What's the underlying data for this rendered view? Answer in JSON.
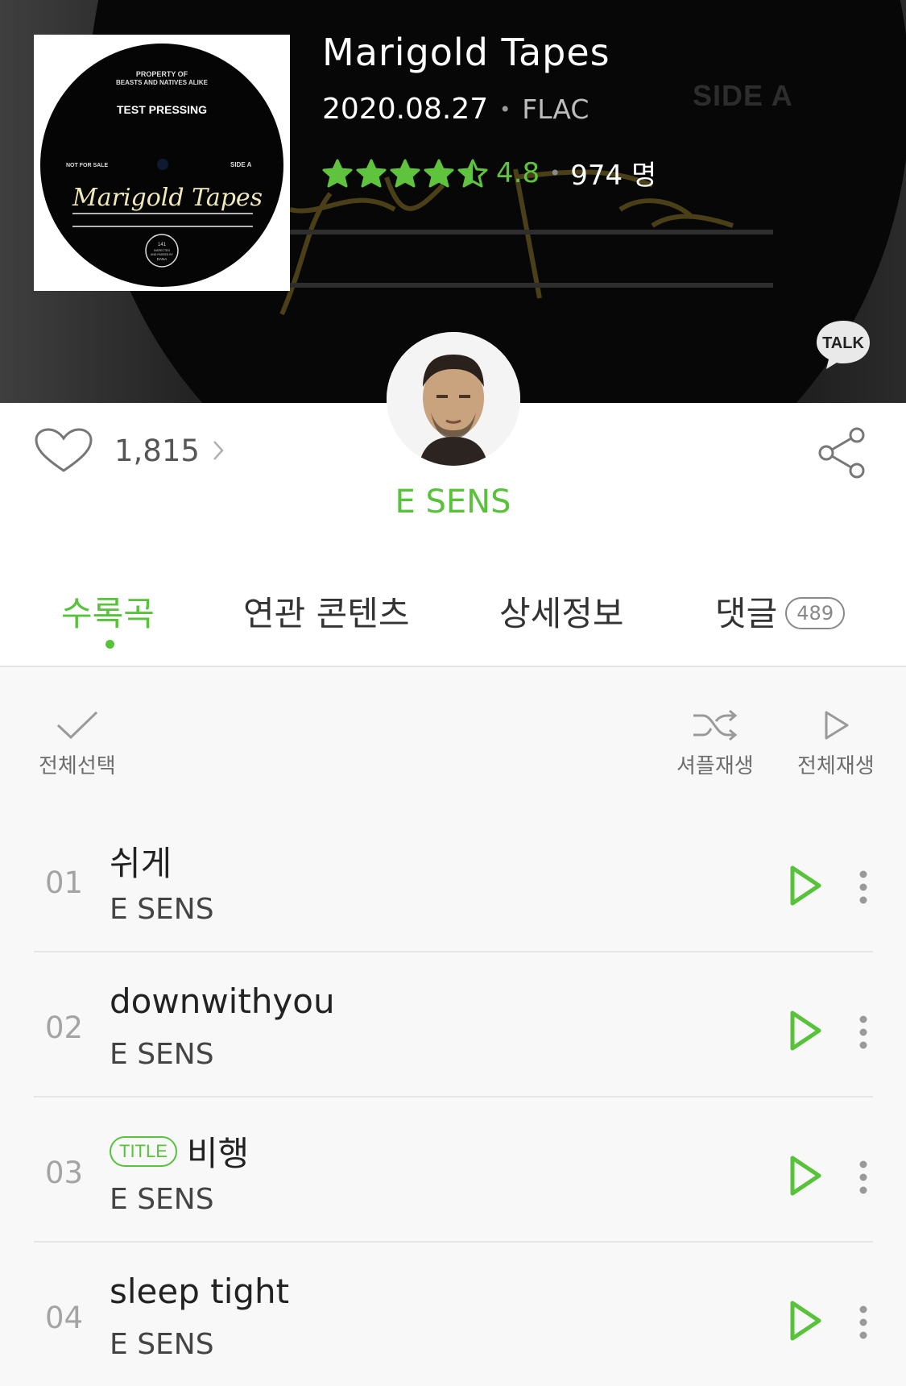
{
  "album": {
    "title": "Marigold Tapes",
    "date": "2020.08.27",
    "format": "FLAC",
    "rating": "4.8",
    "rating_stars": 4.5,
    "rating_count": "974 명",
    "talk_label": "TALK",
    "cover": {
      "line1": "PROPERTY OF",
      "line2": "BEASTS AND NATIVES ALIKE",
      "test_pressing": "TEST PRESSING",
      "not_for_sale": "NOT FOR SALE",
      "side": "SIDE A",
      "script_title": "Marigold Tapes",
      "label_num": "141",
      "label_sub1": "INSPECTED",
      "label_sub2": "AND PASSED BY",
      "label_sub3": "DANA"
    },
    "background_side": "SIDE A"
  },
  "likes": {
    "count": "1,815"
  },
  "artist": {
    "name": "E SENS"
  },
  "tabs": [
    {
      "label": "수록곡"
    },
    {
      "label": "연관 콘텐츠"
    },
    {
      "label": "상세정보"
    },
    {
      "label": "댓글",
      "badge": "489"
    }
  ],
  "actions": {
    "select_all": "전체선택",
    "shuffle": "셔플재생",
    "play_all": "전체재생"
  },
  "tracks": [
    {
      "num": "01",
      "title": "쉬게",
      "artist": "E SENS",
      "tag": ""
    },
    {
      "num": "02",
      "title": "downwithyou",
      "artist": "E SENS",
      "tag": ""
    },
    {
      "num": "03",
      "title": "비행",
      "artist": "E SENS",
      "tag": "TITLE"
    },
    {
      "num": "04",
      "title": "sleep tight",
      "artist": "E SENS",
      "tag": ""
    }
  ],
  "colors": {
    "accent": "#57c23a",
    "star": "#5fc33d",
    "background": "#f8f8f8"
  },
  "icons": [
    "heart-icon",
    "chevron-right-icon",
    "share-icon",
    "talk-icon",
    "check-icon",
    "shuffle-icon",
    "play-icon",
    "more-vertical-icon",
    "star-icon"
  ]
}
